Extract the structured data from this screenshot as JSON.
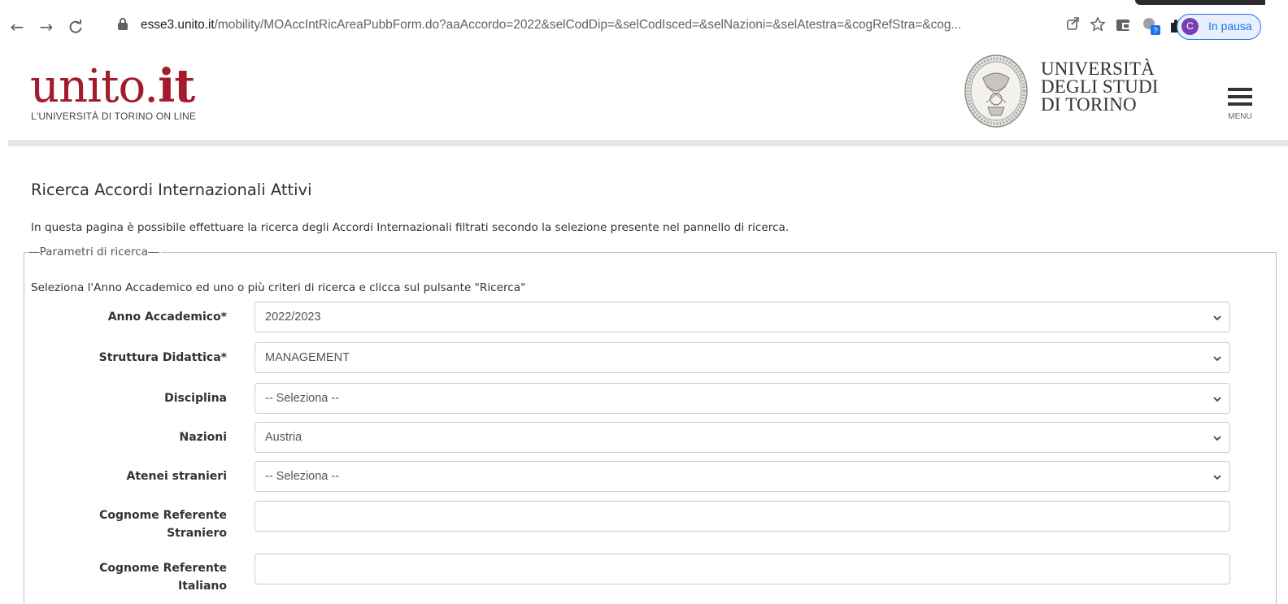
{
  "browser": {
    "url_host": "esse3.unito.it",
    "url_path": "/mobility/MOAccIntRicAreaPubbForm.do?aaAccordo=2022&selCodDip=&selCodIsced=&selNazioni=&selAtestra=&cogRefStra=&cog...",
    "profile_initial": "C",
    "profile_status": "In pausa",
    "nav_back": "←",
    "nav_forward": "→",
    "nav_reload": "C"
  },
  "site": {
    "logo_text_light": "uni",
    "logo_text_mid": "to.",
    "logo_text_bold": "it",
    "tagline": "L'UNIVERSITÀ DI TORINO ON LINE",
    "university_line1": "UNIVERSITÀ",
    "university_line2": "DEGLI STUDI",
    "university_line3": "DI TORINO",
    "menu_label": "MENU"
  },
  "page": {
    "title": "Ricerca Accordi Internazionali Attivi",
    "intro": "In questa pagina è possibile effettuare la ricerca degli Accordi Internazionali filtrati secondo la selezione presente nel pannello di ricerca.",
    "legend": "Parametri di ricerca",
    "instructions": "Seleziona l'Anno Accademico ed uno o più criteri di ricerca e clicca sul pulsante \"Ricerca\""
  },
  "form": {
    "anno": {
      "label": "Anno Accademico*",
      "value": "2022/2023"
    },
    "struttura": {
      "label": "Struttura Didattica*",
      "value": "MANAGEMENT"
    },
    "disciplina": {
      "label": "Disciplina",
      "value": "-- Seleziona --"
    },
    "nazioni": {
      "label": "Nazioni",
      "value": "Austria"
    },
    "atenei": {
      "label": "Atenei stranieri",
      "value": "-- Seleziona --"
    },
    "ref_straniero": {
      "label_line1": "Cognome Referente",
      "label_line2": "Straniero",
      "value": ""
    },
    "ref_italiano": {
      "label_line1": "Cognome Referente",
      "label_line2": "Italiano",
      "value": ""
    }
  },
  "colors": {
    "brand_red": "#a21c2c",
    "chrome_blue": "#1a73e8"
  },
  "icons": [
    "back-arrow-icon",
    "forward-arrow-icon",
    "reload-icon",
    "lock-icon",
    "share-icon",
    "star-icon",
    "extension-icon",
    "puzzle-icon",
    "hamburger-menu-icon",
    "chevron-down-icon"
  ]
}
